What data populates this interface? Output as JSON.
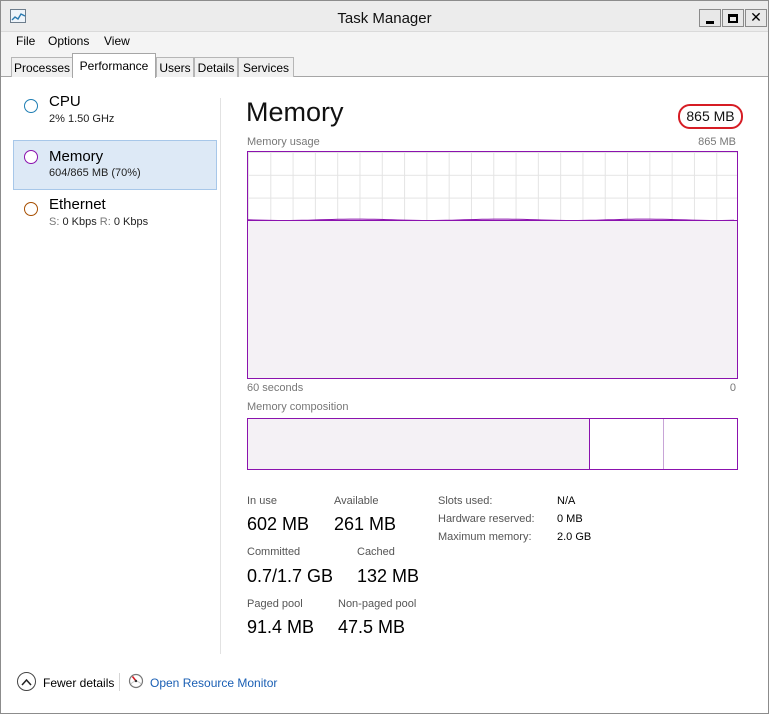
{
  "window": {
    "title": "Task Manager"
  },
  "menu": [
    "File",
    "Options",
    "View"
  ],
  "tabs": [
    "Processes",
    "Performance",
    "Users",
    "Details",
    "Services"
  ],
  "active_tab": "Performance",
  "sidebar": {
    "items": [
      {
        "title": "CPU",
        "sub": "2% 1.50 GHz",
        "color": "#1f7eb3"
      },
      {
        "title": "Memory",
        "sub": "604/865 MB (70%)",
        "color": "#8b12ae"
      },
      {
        "title": "Ethernet",
        "sub_s_label": "S:",
        "sub_s_value": "0 Kbps",
        "sub_r_label": "R:",
        "sub_r_value": "0 Kbps",
        "color": "#a74f01"
      }
    ]
  },
  "main": {
    "title": "Memory",
    "total": "865 MB",
    "usage_label": "Memory usage",
    "usage_max": "865 MB",
    "axis_left": "60 seconds",
    "axis_right": "0",
    "usage_level": 0.7,
    "composition_label": "Memory composition",
    "composition": {
      "in_use_fraction": 0.7,
      "standby_fraction": 0.15,
      "free_fraction": 0.15
    },
    "stats": {
      "in_use_label": "In use",
      "in_use": "602 MB",
      "available_label": "Available",
      "available": "261 MB",
      "committed_label": "Committed",
      "committed": "0.7/1.7 GB",
      "cached_label": "Cached",
      "cached": "132 MB",
      "paged_label": "Paged pool",
      "paged": "91.4 MB",
      "nonpaged_label": "Non-paged pool",
      "nonpaged": "47.5 MB"
    },
    "details": {
      "slots_label": "Slots used:",
      "slots": "N/A",
      "hw_label": "Hardware reserved:",
      "hw": "0 MB",
      "max_label": "Maximum memory:",
      "max": "2.0 GB"
    }
  },
  "footer": {
    "fewer": "Fewer details",
    "monitor": "Open Resource Monitor"
  }
}
